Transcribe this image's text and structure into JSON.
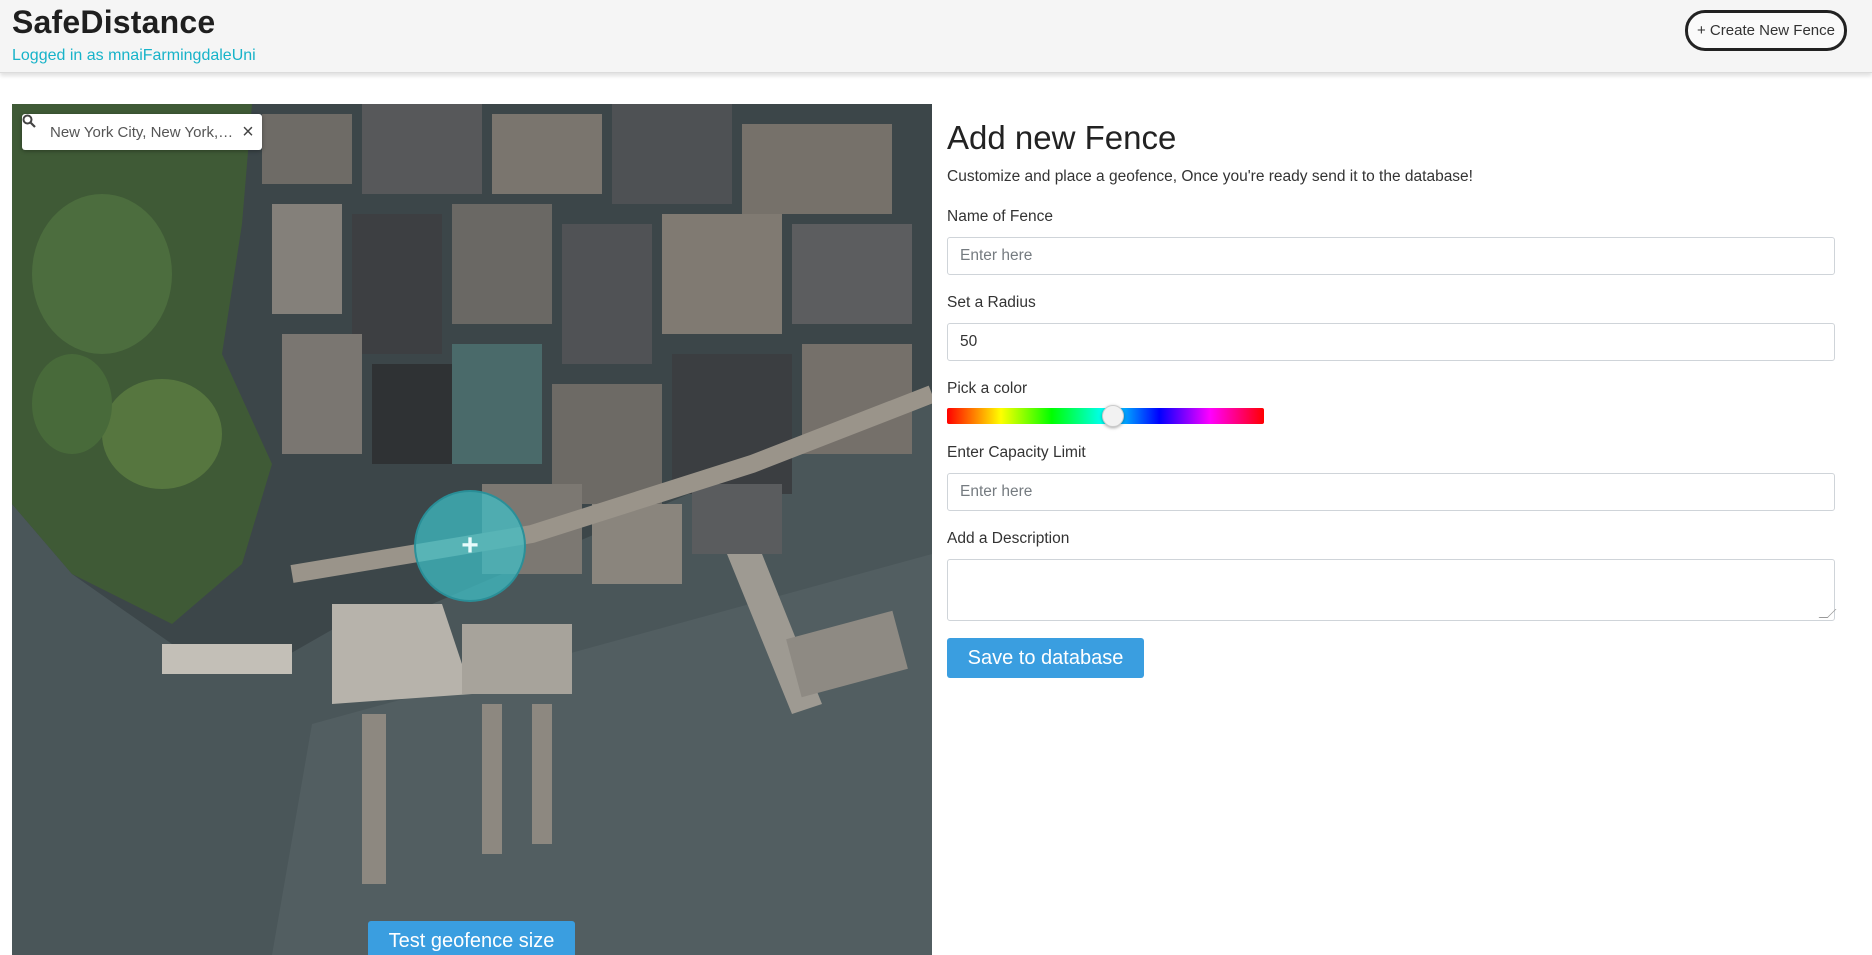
{
  "header": {
    "brand": "SafeDistance",
    "login_status": "Logged in as mnaiFarmingdaleUni",
    "create_button_label": "+ Create New Fence"
  },
  "map": {
    "search_value": "New York City, New York, United States",
    "clear_symbol": "×",
    "test_button_label": "Test geofence size",
    "fence_color": "#3fc0c8"
  },
  "form": {
    "title": "Add new Fence",
    "subtitle": "Customize and place a geofence, Once you're ready send it to the database!",
    "name_label": "Name of Fence",
    "name_placeholder": "Enter here",
    "radius_label": "Set a Radius",
    "radius_value": "50",
    "color_label": "Pick a color",
    "color_hue_fraction": 0.52,
    "capacity_label": "Enter Capacity Limit",
    "capacity_placeholder": "Enter here",
    "description_label": "Add a Description",
    "description_value": "",
    "save_button_label": "Save to database"
  },
  "colors": {
    "accent": "#3a9ee0",
    "login_text": "#17b3c9"
  }
}
